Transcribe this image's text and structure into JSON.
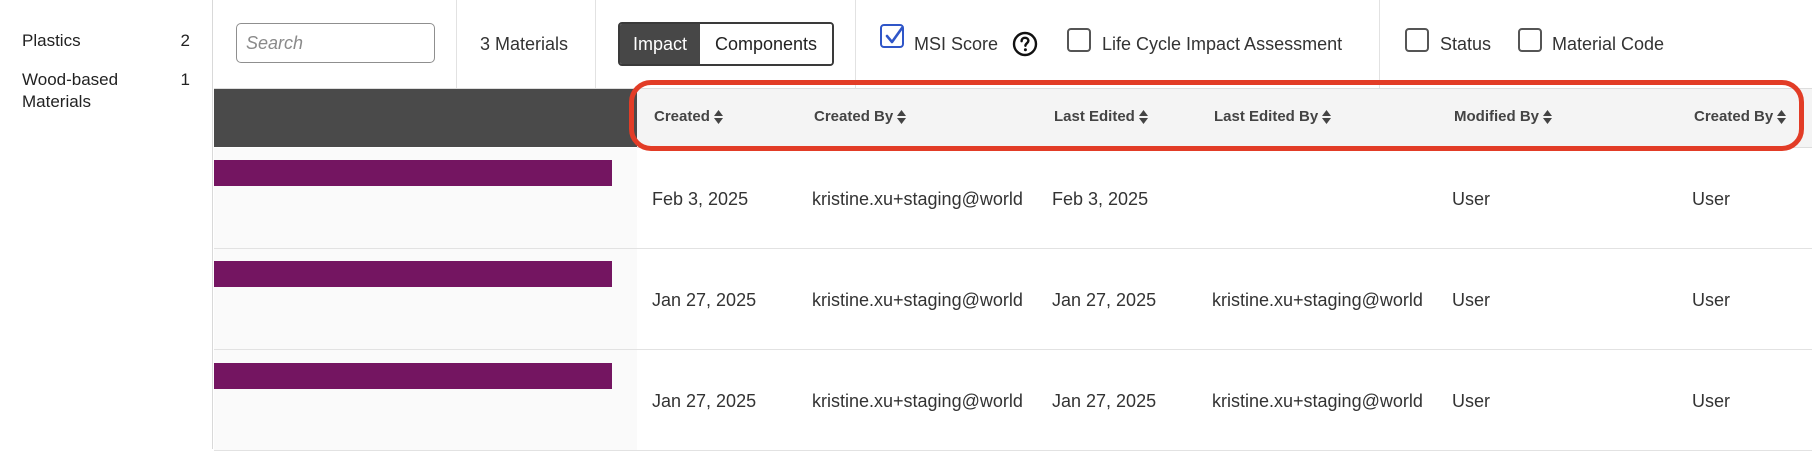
{
  "sidebar": {
    "categories": [
      {
        "label": "Plastics",
        "count": "2"
      },
      {
        "label": "Wood-based Materials",
        "count": "1"
      }
    ]
  },
  "toolbar": {
    "search_placeholder": "Search",
    "search_value": "",
    "materials_count": "3 Materials",
    "view_toggle": {
      "active": "Impact",
      "inactive": "Components"
    },
    "checkboxes": [
      {
        "label": "MSI Score",
        "checked": true
      },
      {
        "label": "Life Cycle Impact Assessment",
        "checked": false
      },
      {
        "label": "Status",
        "checked": false
      },
      {
        "label": "Material Code",
        "checked": false
      }
    ],
    "help_icon": "question-circle-icon"
  },
  "table": {
    "columns": [
      "Created",
      "Created By",
      "Last Edited",
      "Last Edited By",
      "Modified By",
      "Created By"
    ],
    "rows": [
      [
        "Feb 3, 2025",
        "kristine.xu+staging@world",
        "Feb 3, 2025",
        "",
        "User",
        "User"
      ],
      [
        "Jan 27, 2025",
        "kristine.xu+staging@world",
        "Jan 27, 2025",
        "kristine.xu+staging@world",
        "User",
        "User"
      ],
      [
        "Jan 27, 2025",
        "kristine.xu+staging@world",
        "Jan 27, 2025",
        "kristine.xu+staging@world",
        "User",
        "User"
      ]
    ],
    "bar_color": "#741561"
  },
  "colors": {
    "highlight": "#e23c26",
    "checkbox_accent": "#2f56c8",
    "dark_header": "#4a4a4a"
  }
}
